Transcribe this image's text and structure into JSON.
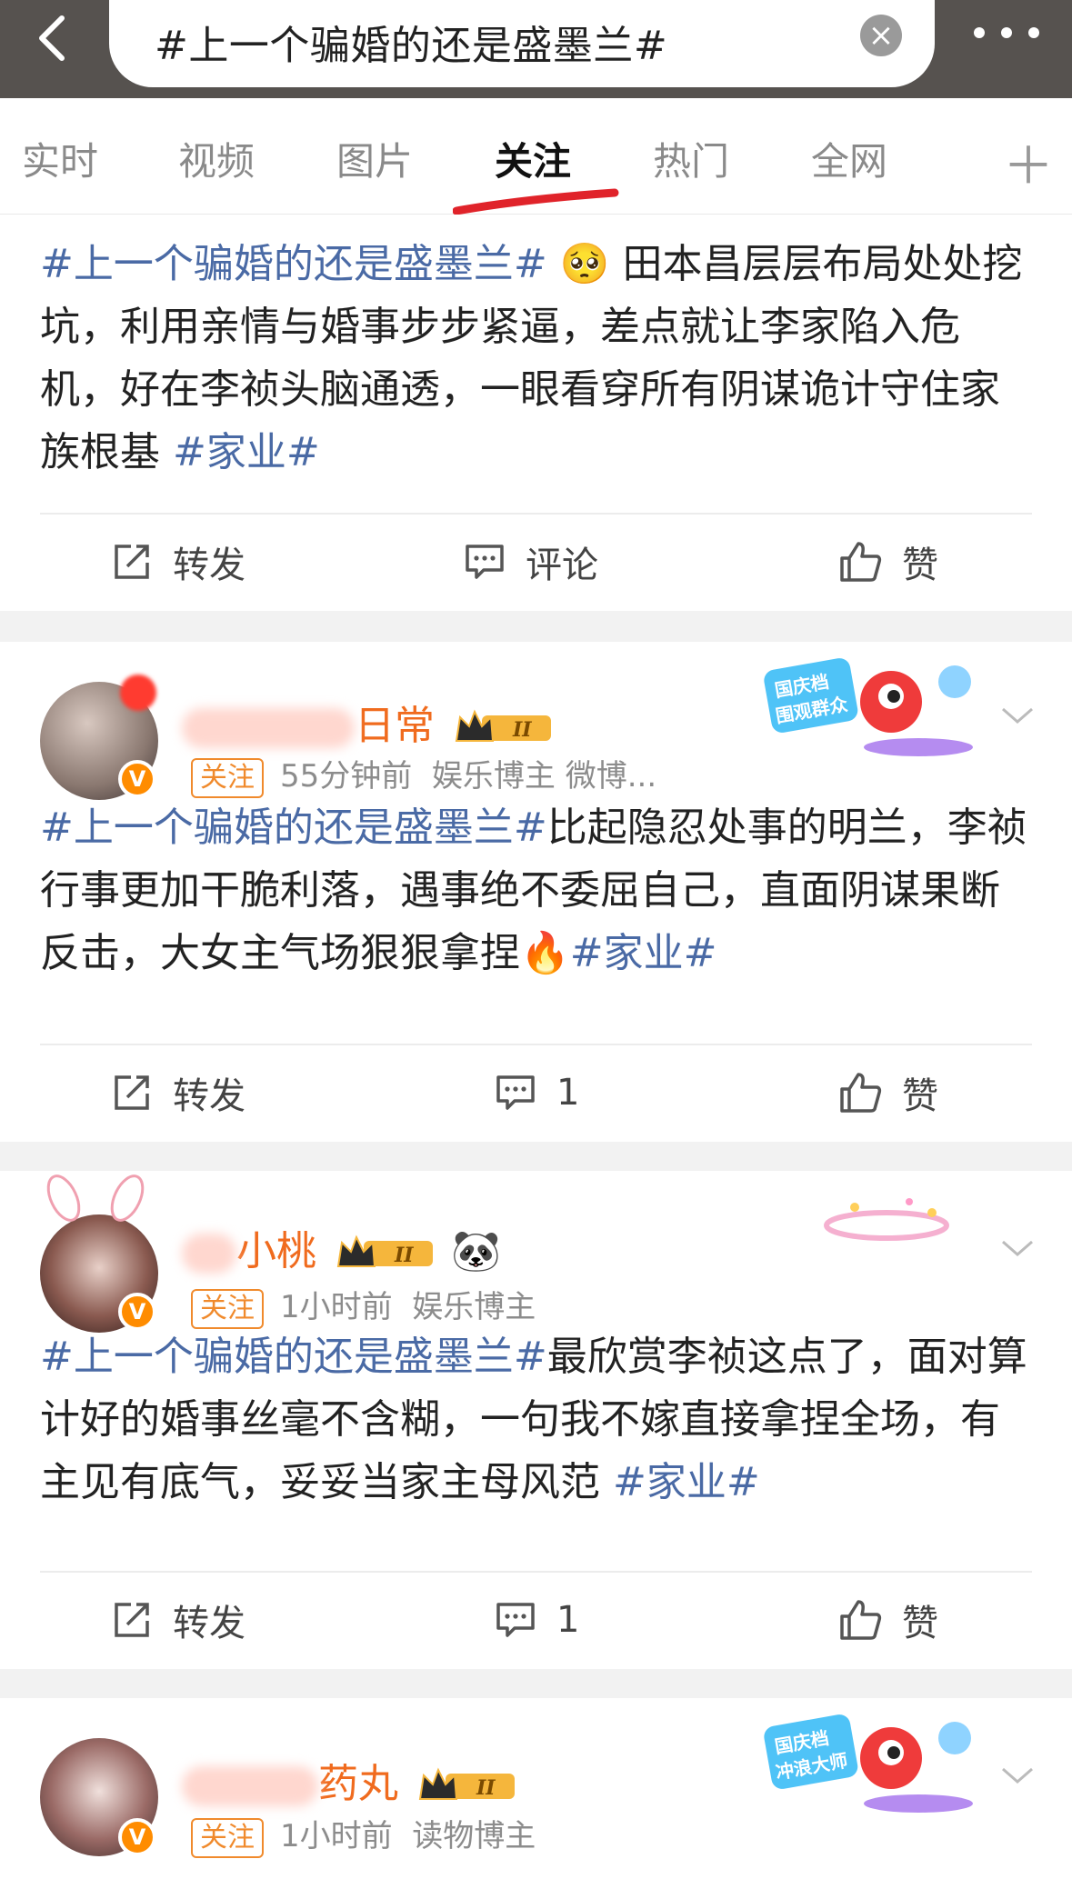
{
  "search": {
    "query": "#上一个骗婚的还是盛墨兰#"
  },
  "tabs": [
    "实时",
    "视频",
    "图片",
    "关注",
    "热门",
    "全网"
  ],
  "active_tab": "关注",
  "actions": {
    "repost": "转发",
    "comment": "评论",
    "like": "赞"
  },
  "posts": [
    {
      "text_tag": "#上一个骗婚的还是盛墨兰#",
      "text_emoji": "🥺",
      "text_body": "田本昌层层布局处处挖坑，利用亲情与婚事步步紧逼，差点就让李家陷入危机，好在李祯头脑通透，一眼看穿所有阴谋诡计守住家族根基",
      "text_tag2": "#家业#"
    },
    {
      "name_visible": "日常",
      "follow": "关注",
      "time": "55分钟前",
      "role": "娱乐博主 微博...",
      "badge_line1": "国庆档",
      "badge_line2": "围观群众",
      "text_tag": "#上一个骗婚的还是盛墨兰#",
      "text_body": "比起隐忍处事的明兰，李祯行事更加干脆利落，遇事绝不委屈自己，直面阴谋果断反击，大女主气场狠狠拿捏",
      "text_emoji": "🔥",
      "text_tag2": "#家业#",
      "comment_count": "1"
    },
    {
      "name_visible": "小桃",
      "follow": "关注",
      "time": "1小时前",
      "role": "娱乐博主",
      "extra_emoji": "🐼",
      "text_tag": "#上一个骗婚的还是盛墨兰#",
      "text_body": "最欣赏李祯这点了，面对算计好的婚事丝毫不含糊，一句我不嫁直接拿捏全场，有主见有底气，妥妥当家主母风范",
      "text_tag2": "#家业#",
      "comment_count": "1"
    },
    {
      "name_visible": "药丸",
      "follow": "关注",
      "time": "1小时前",
      "role": "读物博主",
      "badge_line1": "国庆档",
      "badge_line2": "冲浪大师"
    }
  ],
  "colors": {
    "topbar": "#56524f",
    "tag": "#4a6aa5",
    "name": "#f06b1e",
    "follow": "#f08a2c",
    "tab_underline": "#e0232a"
  },
  "icons": [
    "back-arrow-icon",
    "clear-icon",
    "more-icon",
    "plus-icon",
    "repost-icon",
    "comment-icon",
    "like-icon",
    "chevron-down-icon",
    "crown-level-icon",
    "verified-v-icon"
  ]
}
